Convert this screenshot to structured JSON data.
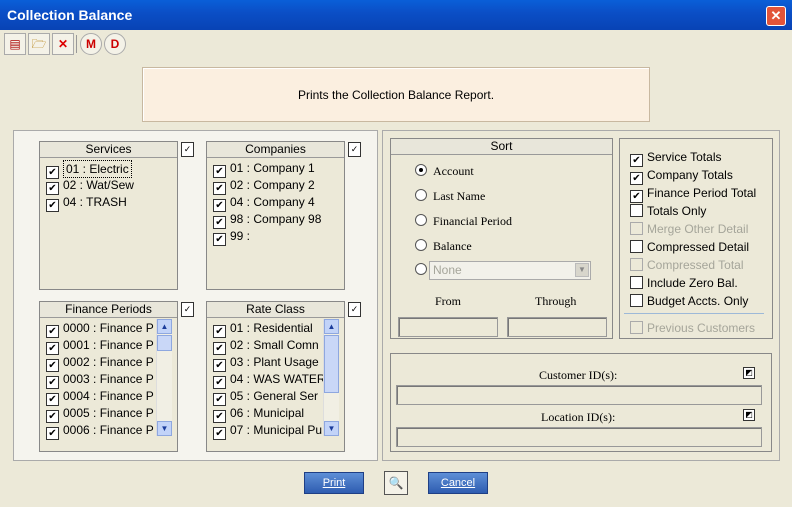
{
  "window": {
    "title": "Collection Balance",
    "close_glyph": "✕"
  },
  "toolbar": {
    "buttons": [
      {
        "name": "report-icon",
        "glyph": "▤"
      },
      {
        "name": "open-folder-icon",
        "glyph": "🗁"
      },
      {
        "name": "delete-icon",
        "glyph": "✕"
      },
      {
        "name": "m-icon",
        "glyph": "M"
      },
      {
        "name": "d-icon",
        "glyph": "D"
      }
    ]
  },
  "info": {
    "text": "Prints the Collection Balance Report."
  },
  "services": {
    "title": "Services",
    "items": [
      "01 : Electric",
      "02 : Wat/Sew",
      "04 : TRASH"
    ]
  },
  "companies": {
    "title": "Companies",
    "items": [
      "01 : Company 1",
      "02 : Company 2",
      "04 : Company 4",
      "98 : Company 98",
      "99 :"
    ]
  },
  "finance_periods": {
    "title": "Finance Periods",
    "items": [
      "0000 : Finance P",
      "0001 : Finance P",
      "0002 : Finance P",
      "0003 : Finance P",
      "0004 : Finance P",
      "0005 : Finance P",
      "0006 : Finance P"
    ]
  },
  "rate_class": {
    "title": "Rate Class",
    "items": [
      "01 : Residential",
      "02 : Small Comn",
      "03 : Plant Usage",
      "04 : WAS WATER",
      "05 : General Ser",
      "06 : Municipal",
      "07 : Municipal Pu"
    ]
  },
  "sort": {
    "title": "Sort",
    "options": [
      "Account",
      "Last Name",
      "Financial Period",
      "Balance"
    ],
    "selected": "Account",
    "custom_placeholder": "None",
    "from_label": "From",
    "through_label": "Through"
  },
  "options": {
    "items": [
      {
        "label": "Service Totals",
        "checked": true,
        "disabled": false
      },
      {
        "label": "Company Totals",
        "checked": true,
        "disabled": false
      },
      {
        "label": "Finance Period Total",
        "checked": true,
        "disabled": false
      },
      {
        "label": "Totals Only",
        "checked": false,
        "disabled": false
      },
      {
        "label": "Merge Other Detail",
        "checked": false,
        "disabled": true
      },
      {
        "label": "Compressed Detail",
        "checked": false,
        "disabled": false
      },
      {
        "label": "Compressed Total",
        "checked": false,
        "disabled": true
      },
      {
        "label": "Include Zero Bal.",
        "checked": false,
        "disabled": false
      },
      {
        "label": "Budget Accts. Only",
        "checked": false,
        "disabled": false
      }
    ],
    "previous_customers": "Previous Customers"
  },
  "ids": {
    "customer_label": "Customer ID(s):",
    "location_label": "Location ID(s):"
  },
  "buttons": {
    "print": "Print",
    "cancel": "Cancel"
  }
}
